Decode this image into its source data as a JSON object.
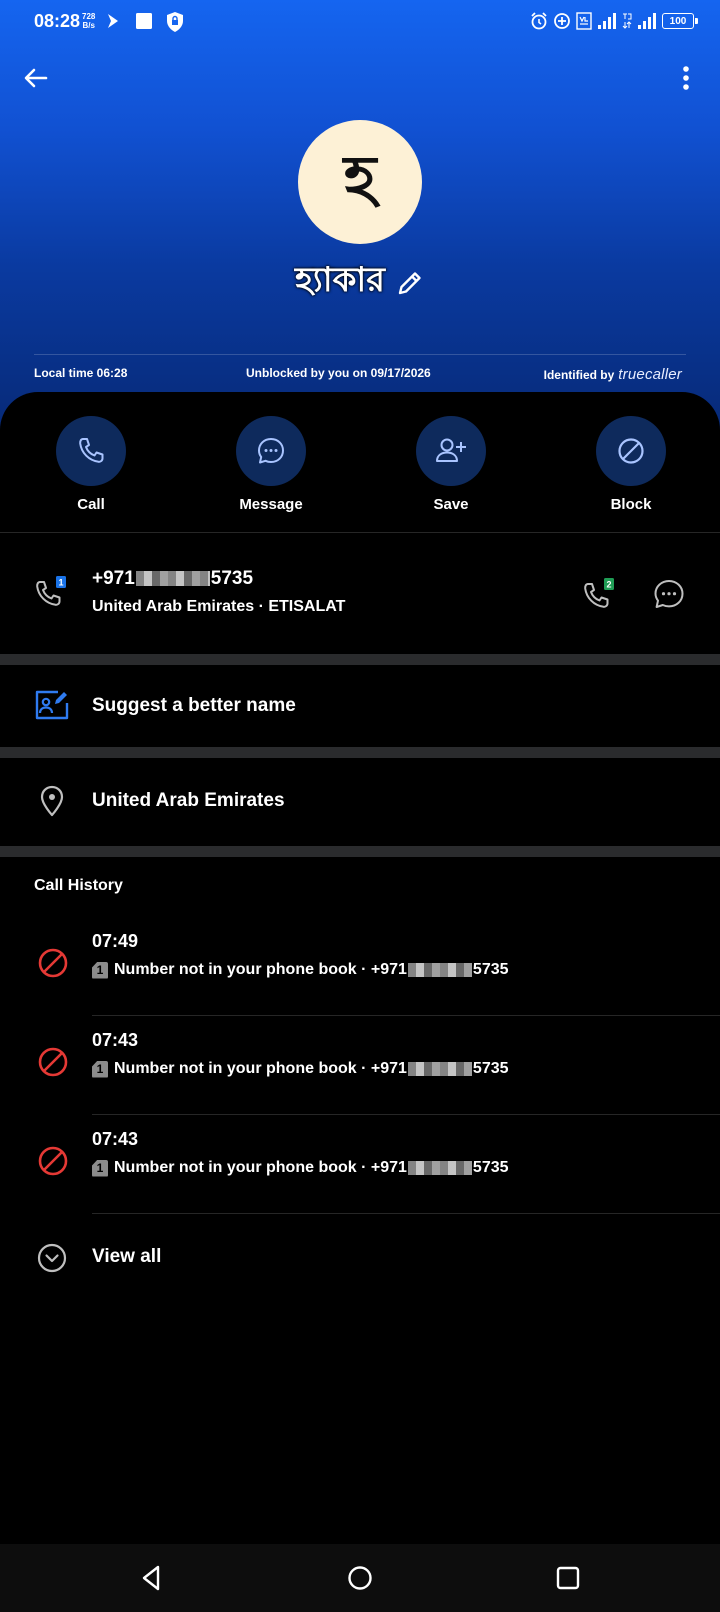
{
  "status_bar": {
    "time": "08:28",
    "net_speed_value": "728",
    "net_speed_unit": "B/s",
    "battery": "100"
  },
  "header": {
    "avatar_letter": "হ",
    "contact_name": "হ্যাকার",
    "local_time": "Local time 06:28",
    "unblocked_text": "Unblocked by you on 09/17/2026",
    "identified_by": "Identified by",
    "brand": "truecaller"
  },
  "actions": [
    {
      "label": "Call",
      "icon": "phone-icon"
    },
    {
      "label": "Message",
      "icon": "chat-bubble-icon"
    },
    {
      "label": "Save",
      "icon": "add-person-icon"
    },
    {
      "label": "Block",
      "icon": "block-icon"
    }
  ],
  "number_row": {
    "prefix": "+971",
    "suffix": "5735",
    "sim": "1",
    "sim2": "2",
    "details": "United Arab Emirates · ETISALAT"
  },
  "suggest_label": "Suggest a better name",
  "location": "United Arab Emirates",
  "call_history": {
    "title": "Call History",
    "items": [
      {
        "time": "07:49",
        "sim": "1",
        "desc": "Number not in your phone book · +971",
        "suffix": "5735"
      },
      {
        "time": "07:43",
        "sim": "1",
        "desc": "Number not in your phone book · +971",
        "suffix": "5735"
      },
      {
        "time": "07:43",
        "sim": "1",
        "desc": "Number not in your phone book · +971",
        "suffix": "5735"
      }
    ],
    "view_all": "View all"
  },
  "colors": {
    "header_top": "#1565f0",
    "header_bottom": "#072a78",
    "action_circle": "#0e2a5c",
    "action_icon": "#a9c4ff",
    "blocked_red": "#e53935",
    "accent_blue": "#1a73e8"
  }
}
